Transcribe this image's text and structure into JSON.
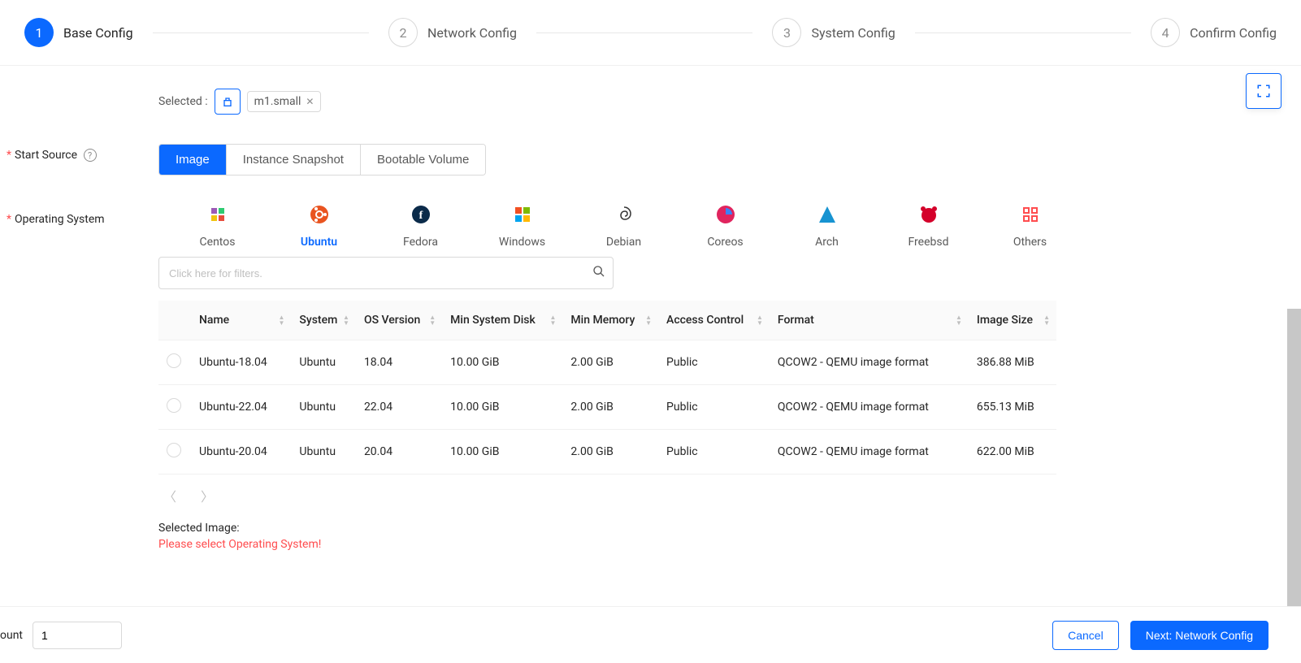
{
  "stepper": {
    "steps": [
      {
        "num": "1",
        "label": "Base Config"
      },
      {
        "num": "2",
        "label": "Network Config"
      },
      {
        "num": "3",
        "label": "System Config"
      },
      {
        "num": "4",
        "label": "Confirm Config"
      }
    ]
  },
  "selected": {
    "label": "Selected :",
    "chip": "m1.small"
  },
  "labels": {
    "start_source": "Start Source",
    "operating_system": "Operating System"
  },
  "source_tabs": [
    "Image",
    "Instance Snapshot",
    "Bootable Volume"
  ],
  "os_list": [
    {
      "name": "Centos",
      "color": "#9b59b6"
    },
    {
      "name": "Ubuntu",
      "color": "#e95420"
    },
    {
      "name": "Fedora",
      "color": "#0b2b4a"
    },
    {
      "name": "Windows",
      "color": "#00a4ef"
    },
    {
      "name": "Debian",
      "color": "#444"
    },
    {
      "name": "Coreos",
      "color": "#e0245e"
    },
    {
      "name": "Arch",
      "color": "#1793d1"
    },
    {
      "name": "Freebsd",
      "color": "#d4002a"
    },
    {
      "name": "Others",
      "color": "#ff4d4f"
    }
  ],
  "os_selected_index": 1,
  "filter_placeholder": "Click here for filters.",
  "table": {
    "columns": [
      "Name",
      "System",
      "OS Version",
      "Min System Disk",
      "Min Memory",
      "Access Control",
      "Format",
      "Image Size"
    ],
    "rows": [
      {
        "name": "Ubuntu-18.04",
        "system": "Ubuntu",
        "ver": "18.04",
        "disk": "10.00 GiB",
        "mem": "2.00 GiB",
        "access": "Public",
        "format": "QCOW2 - QEMU image format",
        "size": "386.88 MiB"
      },
      {
        "name": "Ubuntu-22.04",
        "system": "Ubuntu",
        "ver": "22.04",
        "disk": "10.00 GiB",
        "mem": "2.00 GiB",
        "access": "Public",
        "format": "QCOW2 - QEMU image format",
        "size": "655.13 MiB"
      },
      {
        "name": "Ubuntu-20.04",
        "system": "Ubuntu",
        "ver": "20.04",
        "disk": "10.00 GiB",
        "mem": "2.00 GiB",
        "access": "Public",
        "format": "QCOW2 - QEMU image format",
        "size": "622.00 MiB"
      }
    ]
  },
  "selected_image": {
    "label": "Selected Image:",
    "warn": "Please select Operating System!"
  },
  "footer": {
    "count_label": "ount",
    "count_value": "1",
    "cancel": "Cancel",
    "next": "Next: Network Config"
  }
}
